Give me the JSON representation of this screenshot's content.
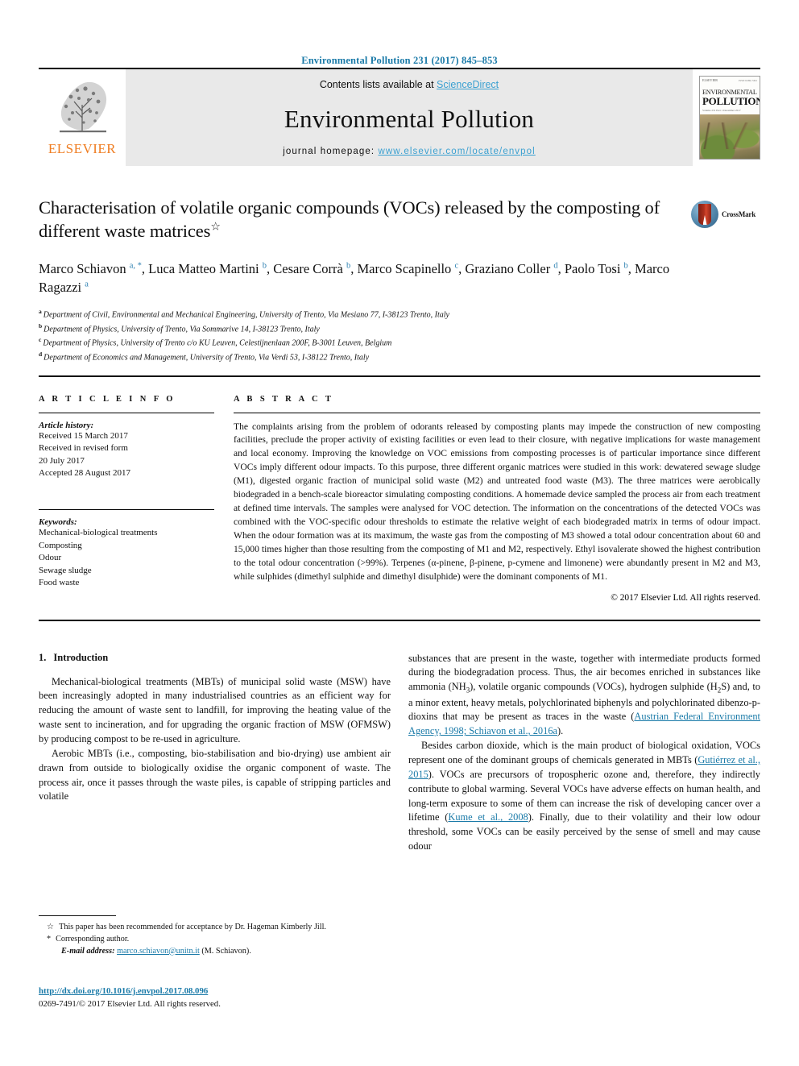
{
  "running_head": "Environmental Pollution 231 (2017) 845–853",
  "masthead": {
    "publisher_wordmark": "ELSEVIER",
    "contents_prefix": "Contents lists available at ",
    "contents_link": "ScienceDirect",
    "journal_name": "Environmental Pollution",
    "homepage_prefix": "journal homepage: ",
    "homepage_link": "www.elsevier.com/locate/envpol",
    "cover": {
      "publisher_small": "ELSEVIER",
      "issn_small": "ISSN 0269-7491",
      "title_line1": "ENVIRONMENTAL",
      "title_line2": "POLLUTION",
      "sub_line1": "Volume 231  Part 1  December 2017",
      "sub_line2": "Editor-in-Chief"
    }
  },
  "article": {
    "title": "Characterisation of volatile organic compounds (VOCs) released by the composting of different waste matrices",
    "title_star": "☆",
    "crossmark_label": "CrossMark",
    "authors": [
      {
        "name": "Marco Schiavon",
        "marks": "a, *",
        "sep": ", "
      },
      {
        "name": "Luca Matteo Martini",
        "marks": "b",
        "sep": ", "
      },
      {
        "name": "Cesare Corrà",
        "marks": "b",
        "sep": ", "
      },
      {
        "name": "Marco Scapinello",
        "marks": "c",
        "sep": ","
      },
      {
        "name": "Graziano Coller",
        "marks": "d",
        "sep": ", "
      },
      {
        "name": "Paolo Tosi",
        "marks": "b",
        "sep": ", "
      },
      {
        "name": "Marco Ragazzi",
        "marks": "a",
        "sep": ""
      }
    ],
    "affiliations": [
      {
        "mark": "a",
        "text": "Department of Civil, Environmental and Mechanical Engineering, University of Trento, Via Mesiano 77, I-38123 Trento, Italy"
      },
      {
        "mark": "b",
        "text": "Department of Physics, University of Trento, Via Sommarive 14, I-38123 Trento, Italy"
      },
      {
        "mark": "c",
        "text": "Department of Physics, University of Trento c/o KU Leuven, Celestijnenlaan 200F, B-3001 Leuven, Belgium"
      },
      {
        "mark": "d",
        "text": "Department of Economics and Management, University of Trento, Via Verdi 53, I-38122 Trento, Italy"
      }
    ]
  },
  "article_info": {
    "heading": "A R T I C L E  I N F O",
    "history_label": "Article history:",
    "history": [
      "Received 15 March 2017",
      "Received in revised form",
      "20 July 2017",
      "Accepted 28 August 2017"
    ],
    "keywords_label": "Keywords:",
    "keywords": [
      "Mechanical-biological treatments",
      "Composting",
      "Odour",
      "Sewage sludge",
      "Food waste"
    ]
  },
  "abstract": {
    "heading": "A B S T R A C T",
    "text": "The complaints arising from the problem of odorants released by composting plants may impede the construction of new composting facilities, preclude the proper activity of existing facilities or even lead to their closure, with negative implications for waste management and local economy. Improving the knowledge on VOC emissions from composting processes is of particular importance since different VOCs imply different odour impacts. To this purpose, three different organic matrices were studied in this work: dewatered sewage sludge (M1), digested organic fraction of municipal solid waste (M2) and untreated food waste (M3). The three matrices were aerobically biodegraded in a bench-scale bioreactor simulating composting conditions. A homemade device sampled the process air from each treatment at defined time intervals. The samples were analysed for VOC detection. The information on the concentrations of the detected VOCs was combined with the VOC-specific odour thresholds to estimate the relative weight of each biodegraded matrix in terms of odour impact. When the odour formation was at its maximum, the waste gas from the composting of M3 showed a total odour concentration about 60 and 15,000 times higher than those resulting from the composting of M1 and M2, respectively. Ethyl isovalerate showed the highest contribution to the total odour concentration (>99%). Terpenes (α-pinene, β-pinene, p-cymene and limonene) were abundantly present in M2 and M3, while sulphides (dimethyl sulphide and dimethyl disulphide) were the dominant components of M1.",
    "copyright": "© 2017 Elsevier Ltd. All rights reserved."
  },
  "introduction": {
    "number": "1.",
    "heading": "Introduction",
    "left_paragraphs": [
      "Mechanical-biological treatments (MBTs) of municipal solid waste (MSW) have been increasingly adopted in many industrialised countries as an efficient way for reducing the amount of waste sent to landfill, for improving the heating value of the waste sent to incineration, and for upgrading the organic fraction of MSW (OFMSW) by producing compost to be re-used in agriculture.",
      "Aerobic MBTs (i.e., composting, bio-stabilisation and bio-drying) use ambient air drawn from outside to biologically oxidise the organic component of waste. The process air, once it passes through the waste piles, is capable of stripping particles and volatile"
    ],
    "right_paragraph_1_pre": "substances that are present in the waste, together with intermediate products formed during the biodegradation process. Thus, the air becomes enriched in substances like ammonia (NH",
    "right_paragraph_1_post": "), volatile organic compounds (VOCs), hydrogen sulphide (H",
    "right_paragraph_1_post2": "S) and, to a minor extent, heavy metals, polychlorinated biphenyls and polychlorinated dibenzo-p-dioxins that may be present as traces in the waste (",
    "right_p1_cite": "Austrian Federal Environment Agency, 1998; Schiavon et al., 2016a",
    "right_p1_end": ").",
    "right_paragraph_2_a": "Besides carbon dioxide, which is the main product of biological oxidation, VOCs represent one of the dominant groups of chemicals generated in MBTs (",
    "right_p2_cite1": "Gutiérrez et al., 2015",
    "right_paragraph_2_b": "). VOCs are precursors of tropospheric ozone and, therefore, they indirectly contribute to global warming. Several VOCs have adverse effects on human health, and long-term exposure to some of them can increase the risk of developing cancer over a lifetime (",
    "right_p2_cite2": "Kume et al., 2008",
    "right_paragraph_2_c": "). Finally, due to their volatility and their low odour threshold, some VOCs can be easily perceived by the sense of smell and may cause odour",
    "sub_nh3": "3",
    "sub_h2s": "2"
  },
  "footnotes": {
    "star_mark": "☆",
    "star_text": "This paper has been recommended for acceptance by Dr. Hageman Kimberly Jill.",
    "corr_mark": "*",
    "corr_text": "Corresponding author.",
    "email_label": "E-mail address:",
    "email": "marco.schiavon@unitn.it",
    "email_suffix": "(M. Schiavon)."
  },
  "imprint": {
    "doi": "http://dx.doi.org/10.1016/j.envpol.2017.08.096",
    "issn_line": "0269-7491/© 2017 Elsevier Ltd. All rights reserved."
  },
  "colors": {
    "link_blue": "#1a7aa8",
    "science_direct_blue": "#3aa0d1",
    "elsevier_orange": "#ef7d22",
    "band_grey": "#e9e9e9"
  }
}
